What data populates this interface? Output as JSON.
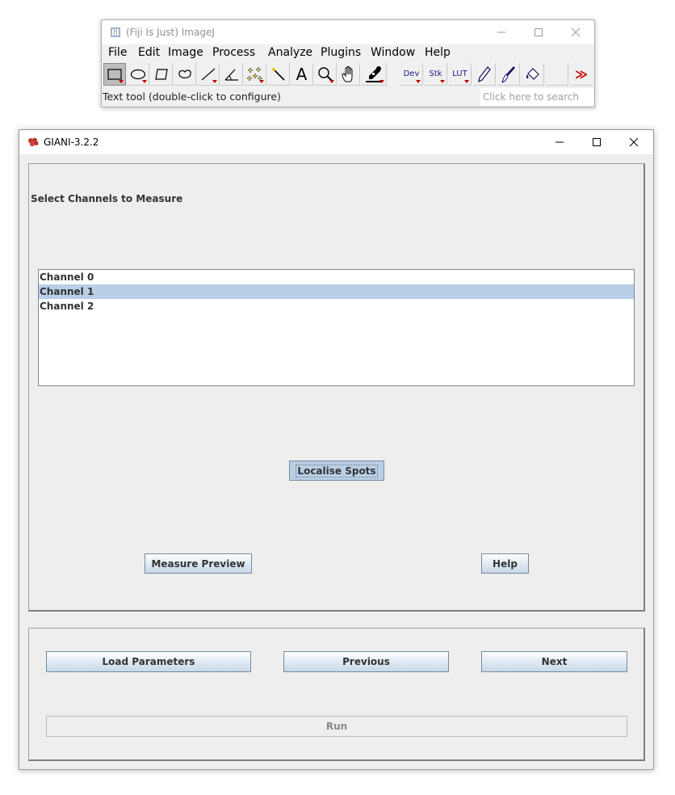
{
  "imagej": {
    "title": "(Fiji Is Just) ImageJ",
    "menus": [
      "File",
      "Edit",
      "Image",
      "Process",
      "Analyze",
      "Plugins",
      "Window",
      "Help"
    ],
    "tools": {
      "dev": "Dev",
      "stk": "Stk",
      "lut": "LUT",
      "text_tool": "A",
      "more": "≫"
    },
    "status": "Text tool (double-click to configure)",
    "search_placeholder": "Click here to search"
  },
  "giani": {
    "title": "GIANI-3.2.2",
    "heading": "Select Channels to Measure",
    "channels": [
      "Channel 0",
      "Channel 1",
      "Channel 2"
    ],
    "selected_channel_index": 1,
    "buttons": {
      "localise": "Localise Spots",
      "measure_preview": "Measure Preview",
      "help": "Help",
      "load_parameters": "Load Parameters",
      "previous": "Previous",
      "next": "Next",
      "run": "Run"
    }
  },
  "colors": {
    "selection": "#b8cfe5",
    "panel_bg": "#eeeeee",
    "toolbar_more": "#c00000"
  }
}
